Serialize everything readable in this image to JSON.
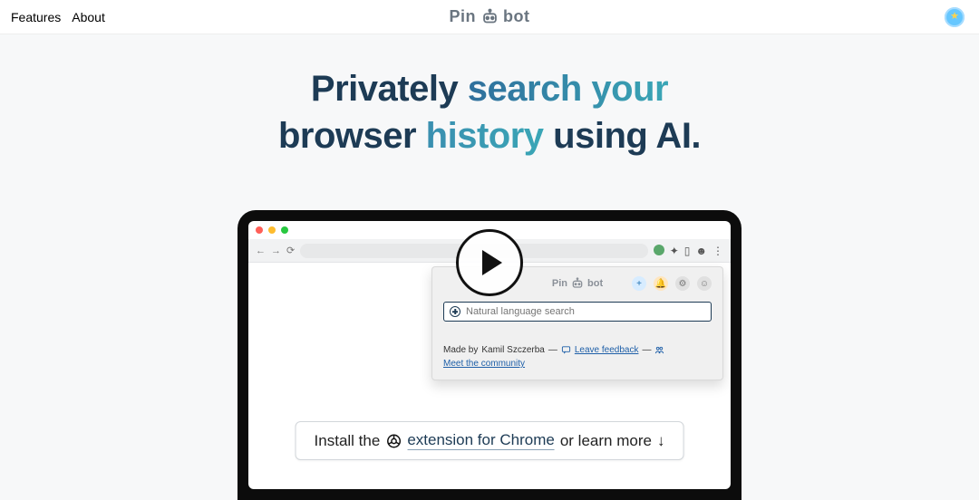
{
  "nav": {
    "features": "Features",
    "about": "About"
  },
  "brand": {
    "prefix": "Pin",
    "suffix": "bot",
    "accent": "#6a7580"
  },
  "headline": {
    "line1_a": "Privately ",
    "line1_b": "search your",
    "line2_a": "browser ",
    "line2_b": "history",
    "line2_c": " using AI."
  },
  "popup": {
    "brand_prefix": "Pin",
    "brand_suffix": "bot",
    "search_placeholder": "Natural language search",
    "footer_made_by": "Made by ",
    "footer_author": "Kamil Szczerba",
    "footer_feedback": "Leave feedback",
    "footer_community": "Meet the community",
    "sep": " — "
  },
  "cta": {
    "prefix": "Install the ",
    "chrome_text": "extension for Chrome",
    "suffix": " or learn more ",
    "arrow": "↓"
  }
}
